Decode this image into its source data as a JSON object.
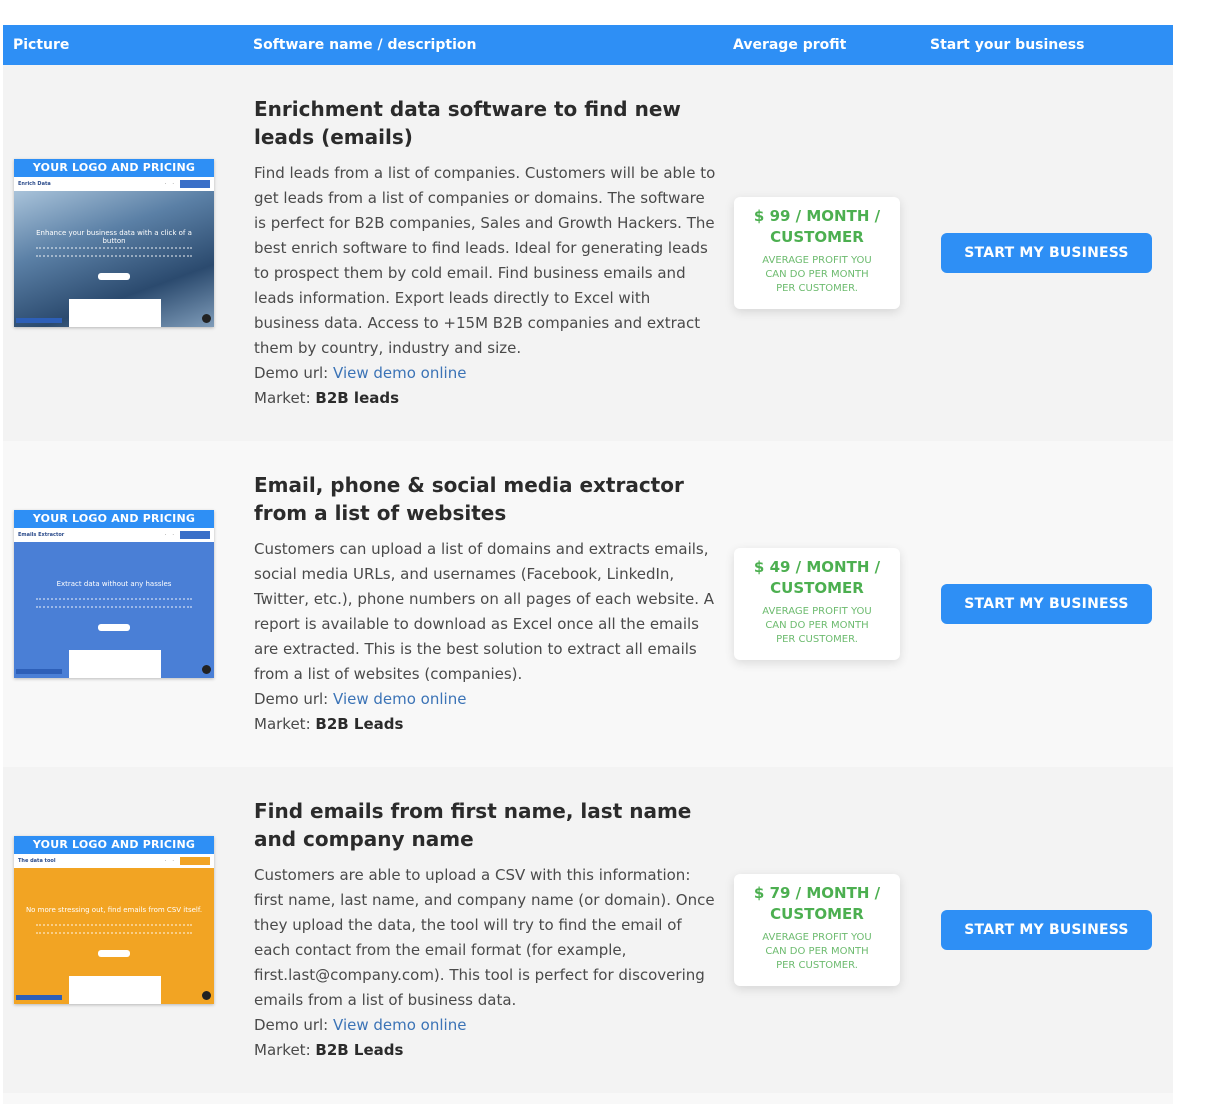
{
  "header": {
    "picture": "Picture",
    "software": "Software name / description",
    "profit": "Average profit",
    "start": "Start your business"
  },
  "common": {
    "banner": "YOUR LOGO AND PRICING",
    "demo_prefix": "Demo url:",
    "demo_link": "View demo online",
    "market_prefix": "Market:",
    "profit_note": "AVERAGE PROFIT YOU CAN DO PER MONTH PER CUSTOMER.",
    "cta": "START MY BUSINESS"
  },
  "rows": [
    {
      "title": "Enrichment data software to find new leads (emails)",
      "description": "Find leads from a list of companies. Customers will be able to get leads from a list of companies or domains. The software is perfect for B2B companies, Sales and Growth Hackers. The best enrich software to find leads. Ideal for generating leads to prospect them by cold email. Find business emails and leads information. Export leads directly to Excel with business data. Access to +15M B2B companies and extract them by country, industry and size.",
      "market": "B2B leads",
      "profit": "$ 99 / MONTH / CUSTOMER",
      "thumb_brand": "Enrich Data",
      "thumb_hero": "Enhance your business data with a click of a button"
    },
    {
      "title": "Email, phone & social media extractor from a list of websites",
      "description": "Customers can upload a list of domains and extracts emails, social media URLs, and usernames (Facebook, LinkedIn, Twitter, etc.), phone numbers on all pages of each website. A report is available to download as Excel once all the emails are extracted. This is the best solution to extract all emails from a list of websites (companies).",
      "market": "B2B Leads",
      "profit": "$ 49 / MONTH / CUSTOMER",
      "thumb_brand": "Emails Extractor",
      "thumb_hero": "Extract data without any hassles"
    },
    {
      "title": "Find emails from first name, last name and company name",
      "description": "Customers are able to upload a CSV with this information: first name, last name, and company name (or domain). Once they upload the data, the tool will try to find the email of each contact from the email format (for example, first.last@company.com). This tool is perfect for discovering emails from a list of business data.",
      "market": "B2B Leads",
      "profit": "$ 79 / MONTH / CUSTOMER",
      "thumb_brand": "The data tool",
      "thumb_hero": "No more stressing out, find emails from CSV itself."
    }
  ]
}
